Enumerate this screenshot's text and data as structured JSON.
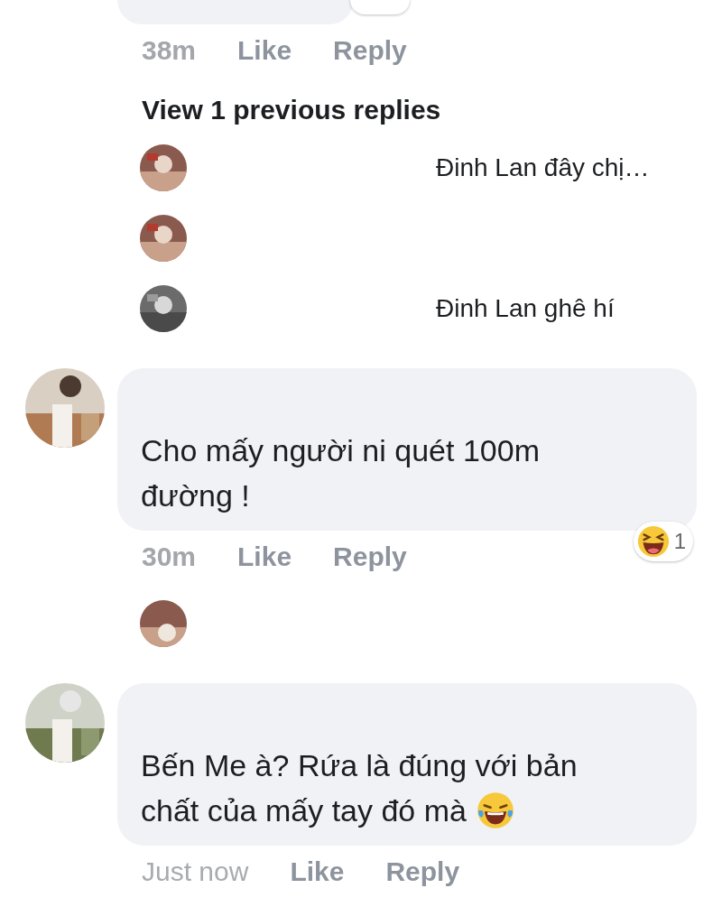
{
  "top_comment": {
    "time": "38m",
    "actions": [
      "Like",
      "Reply"
    ]
  },
  "view_previous": "View 1 previous replies",
  "replies": [
    {
      "kind": "text",
      "message": "Đinh Lan  đây chị…"
    },
    {
      "kind": "redacted"
    },
    {
      "kind": "text",
      "message": "Đinh Lan  ghê hí"
    }
  ],
  "comments": [
    {
      "lines": [
        "Cho mấy người ni quét 100m",
        "đường !"
      ],
      "emoji": false,
      "time": "30m",
      "actions": [
        "Like",
        "Reply"
      ],
      "reaction_count": "1",
      "collapsed_reply": true
    },
    {
      "lines": [
        "Bến Me à? Rứa là đúng với bản",
        "chất của mấy tay đó mà"
      ],
      "emoji": true,
      "time": "Just now",
      "actions": [
        "Like",
        "Reply"
      ]
    }
  ]
}
